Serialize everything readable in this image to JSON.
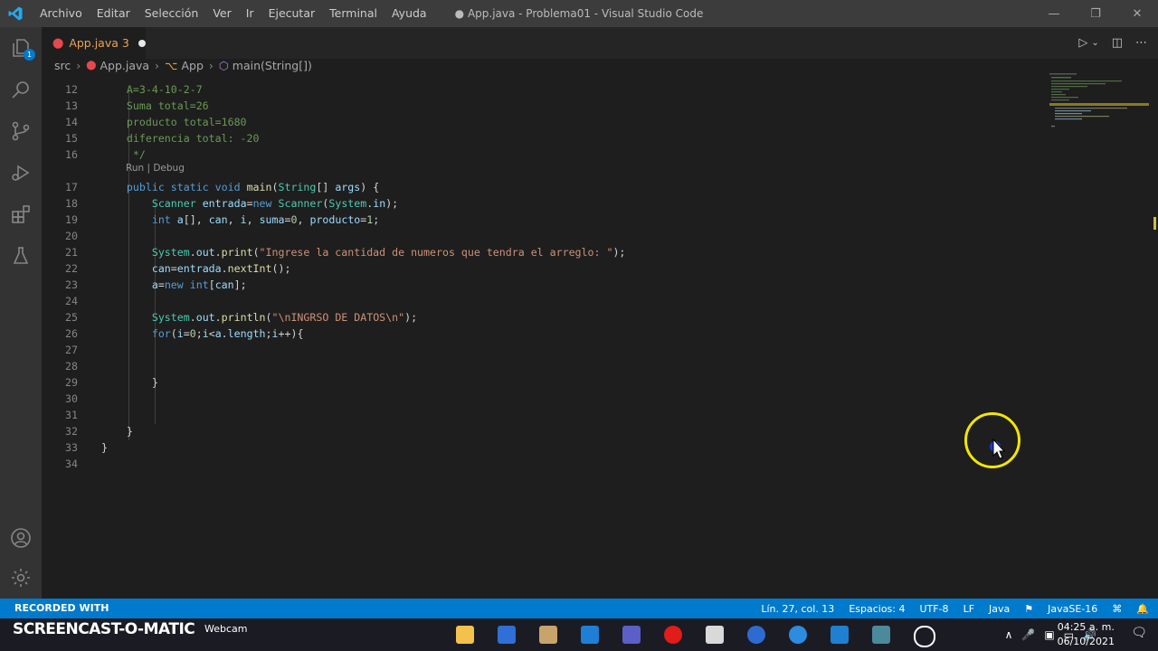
{
  "titlebar": {
    "menu": [
      "Archivo",
      "Editar",
      "Selección",
      "Ver",
      "Ir",
      "Ejecutar",
      "Terminal",
      "Ayuda"
    ],
    "title": "● App.java - Problema01 - Visual Studio Code"
  },
  "activity_badge": "1",
  "tab": {
    "name": "App.java",
    "problems": "3"
  },
  "breadcrumb": {
    "folder": "src",
    "file": "App.java",
    "class": "App",
    "method": "main(String[])"
  },
  "codelens": "Run | Debug",
  "lines": [
    {
      "n": "12",
      "t": "    A=3-4-10-2-7"
    },
    {
      "n": "13",
      "t": "    Suma total=26"
    },
    {
      "n": "14",
      "t": "    producto total=1680"
    },
    {
      "n": "15",
      "t": "    diferencia total: -20"
    },
    {
      "n": "16",
      "t": "     */"
    },
    {
      "n": "17",
      "t": "    public static void main(String[] args) {"
    },
    {
      "n": "18",
      "t": "        Scanner entrada=new Scanner(System.in);"
    },
    {
      "n": "19",
      "t": "        int a[], can, i, suma=0, producto=1;"
    },
    {
      "n": "20",
      "t": ""
    },
    {
      "n": "21",
      "t": "        System.out.print(\"Ingrese la cantidad de numeros que tendra el arreglo: \");"
    },
    {
      "n": "22",
      "t": "        can=entrada.nextInt();"
    },
    {
      "n": "23",
      "t": "        a=new int[can];"
    },
    {
      "n": "24",
      "t": ""
    },
    {
      "n": "25",
      "t": "        System.out.println(\"\\nINGRSO DE DATOS\\n\");"
    },
    {
      "n": "26",
      "t": "        for(i=0;i<a.length;i++){"
    },
    {
      "n": "27",
      "t": ""
    },
    {
      "n": "28",
      "t": ""
    },
    {
      "n": "29",
      "t": "        }"
    },
    {
      "n": "30",
      "t": ""
    },
    {
      "n": "31",
      "t": ""
    },
    {
      "n": "32",
      "t": "    }"
    },
    {
      "n": "33",
      "t": "}"
    },
    {
      "n": "34",
      "t": ""
    }
  ],
  "statusbar": {
    "recorded": "RECORDED WITH",
    "position": "Lín. 27, col. 13",
    "spaces": "Espacios: 4",
    "encoding": "UTF-8",
    "eol": "LF",
    "language": "Java",
    "runtime": "JavaSE-16"
  },
  "taskbar": {
    "brand": "SCREENCAST-O-MATIC",
    "webcam": "Webcam",
    "time": "04:25 a. m.",
    "date": "06/10/2021"
  },
  "colors": {
    "statusbar": "#007acc",
    "titlebar": "#3c3c3c",
    "editor": "#1e1e1e",
    "cursor_ring": "#f2e600"
  }
}
